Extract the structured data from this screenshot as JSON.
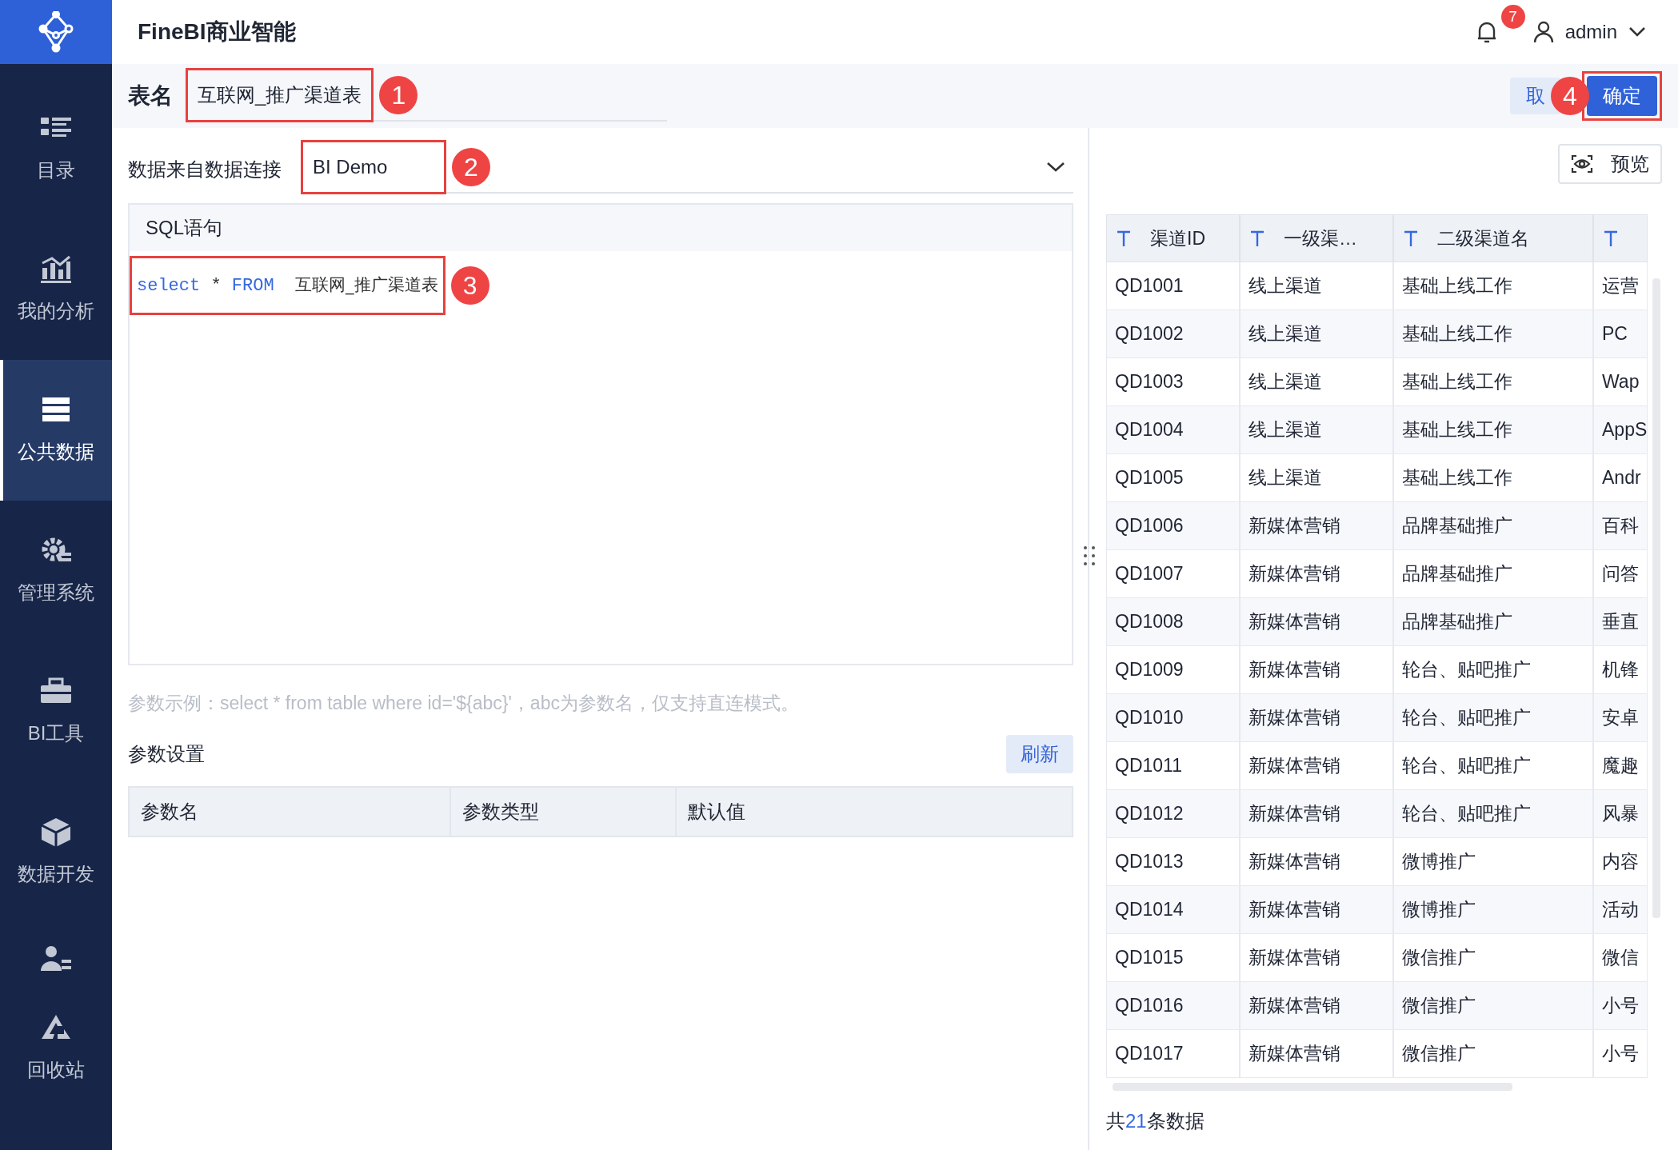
{
  "app": {
    "title": "FineBI商业智能"
  },
  "sidebar": {
    "items": [
      {
        "label": "目录",
        "selected": false
      },
      {
        "label": "我的分析",
        "selected": false
      },
      {
        "label": "公共数据",
        "selected": true
      },
      {
        "label": "管理系统",
        "selected": false
      },
      {
        "label": "BI工具",
        "selected": false
      },
      {
        "label": "数据开发",
        "selected": false
      },
      {
        "selected": false
      },
      {
        "label": "回收站",
        "selected": false
      }
    ]
  },
  "topbar": {
    "notification_count": "7",
    "user": "admin"
  },
  "header": {
    "table_name_label": "表名",
    "table_name": "互联网_推广渠道表",
    "cancel_button": "取",
    "confirm_button": "确定"
  },
  "connection": {
    "label": "数据来自数据连接",
    "value": "BI Demo"
  },
  "sql": {
    "title": "SQL语句",
    "tokens": [
      {
        "text": "select",
        "kind": "keyword"
      },
      {
        "text": "*",
        "kind": "plain"
      },
      {
        "text": "FROM",
        "kind": "keyword"
      },
      {
        "text": "互联网_推广渠道表",
        "kind": "plain"
      }
    ]
  },
  "hint": "参数示例：select * from table where id='${abc}'，abc为参数名，仅支持直连模式。",
  "params": {
    "title": "参数设置",
    "refresh_button": "刷新",
    "columns": [
      "参数名",
      "参数类型",
      "默认值"
    ]
  },
  "preview": {
    "button": "预览",
    "columns": [
      "渠道ID",
      "一级渠…",
      "二级渠道名",
      ""
    ],
    "rows": [
      [
        "QD1001",
        "线上渠道",
        "基础上线工作",
        "运营"
      ],
      [
        "QD1002",
        "线上渠道",
        "基础上线工作",
        "PC"
      ],
      [
        "QD1003",
        "线上渠道",
        "基础上线工作",
        "Wap"
      ],
      [
        "QD1004",
        "线上渠道",
        "基础上线工作",
        "AppS"
      ],
      [
        "QD1005",
        "线上渠道",
        "基础上线工作",
        "Andr"
      ],
      [
        "QD1006",
        "新媒体营销",
        "品牌基础推广",
        "百科"
      ],
      [
        "QD1007",
        "新媒体营销",
        "品牌基础推广",
        "问答"
      ],
      [
        "QD1008",
        "新媒体营销",
        "品牌基础推广",
        "垂直"
      ],
      [
        "QD1009",
        "新媒体营销",
        "轮台、贴吧推广",
        "机锋"
      ],
      [
        "QD1010",
        "新媒体营销",
        "轮台、贴吧推广",
        "安卓"
      ],
      [
        "QD1011",
        "新媒体营销",
        "轮台、贴吧推广",
        "魔趣"
      ],
      [
        "QD1012",
        "新媒体营销",
        "轮台、贴吧推广",
        "风暴"
      ],
      [
        "QD1013",
        "新媒体营销",
        "微博推广",
        "内容"
      ],
      [
        "QD1014",
        "新媒体营销",
        "微博推广",
        "活动"
      ],
      [
        "QD1015",
        "新媒体营销",
        "微信推广",
        "微信"
      ],
      [
        "QD1016",
        "新媒体营销",
        "微信推广",
        "小号"
      ],
      [
        "QD1017",
        "新媒体营销",
        "微信推广",
        "小号"
      ]
    ],
    "footer": {
      "prefix": "共",
      "count": "21",
      "suffix": "条数据"
    }
  },
  "annotations": [
    {
      "number": "1"
    },
    {
      "number": "2"
    },
    {
      "number": "3"
    },
    {
      "number": "4"
    }
  ]
}
